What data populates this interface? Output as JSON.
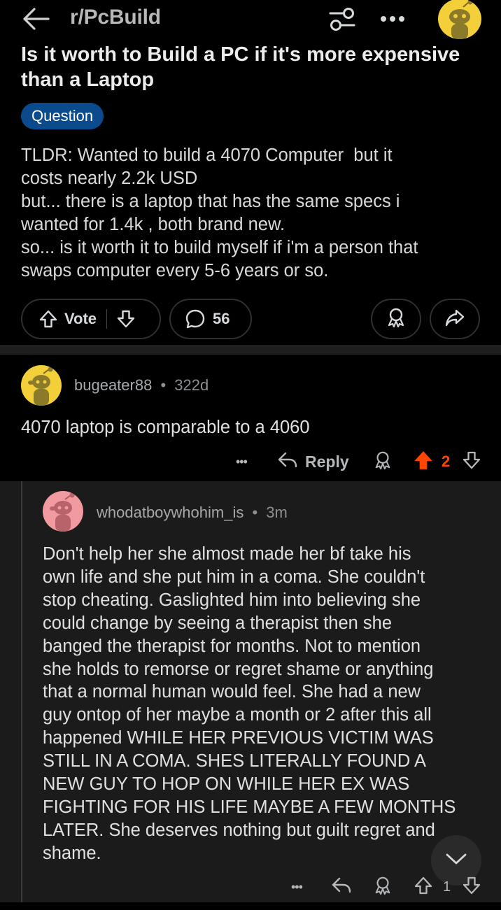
{
  "header": {
    "subreddit": "r/PcBuild",
    "icons": [
      "back-arrow-icon",
      "filter-icon",
      "more-icon",
      "avatar"
    ]
  },
  "post": {
    "title_lines": [
      "Is it worth to Build a PC if it's more expensive",
      "than a Laptop"
    ],
    "flair": "Question",
    "body_lines": [
      "TLDR: Wanted to build a 4070 Computer  but it",
      "costs nearly 2.2k USD",
      "but... there is a laptop that has the same specs i",
      "wanted for 1.4k , both brand new.",
      "so... is it worth it to build myself if i'm a person that",
      "swaps computer every 5-6 years or so."
    ],
    "vote_label": "Vote",
    "comment_count": "56"
  },
  "comment1": {
    "username": "bugeater88",
    "separator": "•",
    "age": "322d",
    "body": "4070 laptop is comparable to a 4060",
    "more": "•••",
    "reply_label": "Reply",
    "score": "2"
  },
  "comment2": {
    "username": "whodatboywhohim_is",
    "separator": "•",
    "age": "3m",
    "body_lines": [
      "Don't help her she almost made her bf take his",
      "own life and she put him in a coma. She couldn't",
      "stop cheating. Gaslighted him into believing she",
      "could change by seeing a therapist then she",
      "banged the therapist for months. Not to mention",
      "she holds to remorse or regret shame or anything",
      "that a normal human would feel. She had a new",
      "guy ontop of her maybe a month or 2 after this all",
      "happened WHILE HER PREVIOUS VICTIM WAS",
      "STILL IN A COMA. SHES LITERALLY FOUND A",
      "NEW GUY TO HOP ON WHILE HER EX WAS",
      "FIGHTING FOR HIS LIFE MAYBE A FEW MONTHS",
      "LATER. She deserves nothing but guilt regret and",
      "shame."
    ],
    "more": "•••",
    "score": "1"
  },
  "colors": {
    "background": "#000000",
    "reply_background": "#1b1b1b",
    "flair": "#0b4a8c",
    "upvoted": "#ff4500",
    "avatar_yellow": "#f3cf3a",
    "avatar_pink": "#f19aa0"
  }
}
